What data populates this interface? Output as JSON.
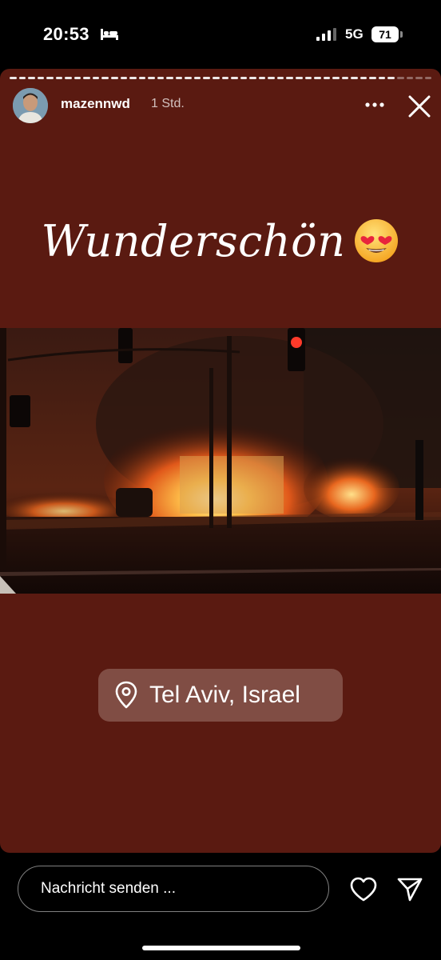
{
  "status_bar": {
    "time": "20:53",
    "network": "5G",
    "battery": "71"
  },
  "story": {
    "background_color": "#5a1a11",
    "progress_segments": 46,
    "progress_seen": 42,
    "username": "mazennwd",
    "time_ago": "1 Std.",
    "caption": "Wunderschön",
    "caption_emoji": "smiling-face-with-heart-eyes",
    "location": "Tel Aviv, Israel"
  },
  "reply": {
    "placeholder": "Nachricht senden ..."
  },
  "icons": {
    "more": "more-horizontal-icon",
    "close": "close-icon",
    "location": "map-pin-icon",
    "like": "heart-icon",
    "share": "send-icon"
  }
}
